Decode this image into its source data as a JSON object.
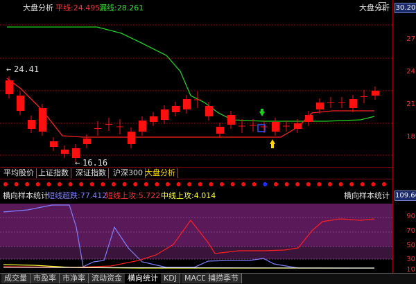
{
  "main": {
    "title": "大盘分析",
    "ma_red": "平线:24.495",
    "ma_green": "漏线:28.261",
    "title_right": "大盘分析",
    "high_label": "24.41",
    "low_label": "16.16"
  },
  "axis": {
    "top_value": "30.20",
    "labels": [
      "27",
      "24",
      "21",
      "18"
    ],
    "sub_value": "109.66",
    "sub_labels": [
      "90",
      "70",
      "50",
      "30",
      "10"
    ]
  },
  "tabs": [
    "平均股价",
    "上证指数",
    "深证指数",
    "沪深300",
    "大盘分析"
  ],
  "active_tab": 4,
  "sub": {
    "title": "横向样本统计",
    "short_over": "短线超跌:77.412",
    "short_up": "短线上攻:5.722",
    "mid_up": "中线上攻:4.014",
    "title_right": "横向样本统计"
  },
  "bottom_tabs": [
    "成交量",
    "市盈率",
    "市净率",
    "流动资金",
    "横向统计",
    "KDJ",
    "MACD",
    "捕捞季节"
  ],
  "active_bottom_tab": 4,
  "colors": {
    "up": "#ff1010",
    "green_line": "#20d020",
    "purple_band": "#5a1a5a",
    "short_over": "#8080ff",
    "short_up": "#ff2020",
    "mid_up": "#ffff30"
  }
}
